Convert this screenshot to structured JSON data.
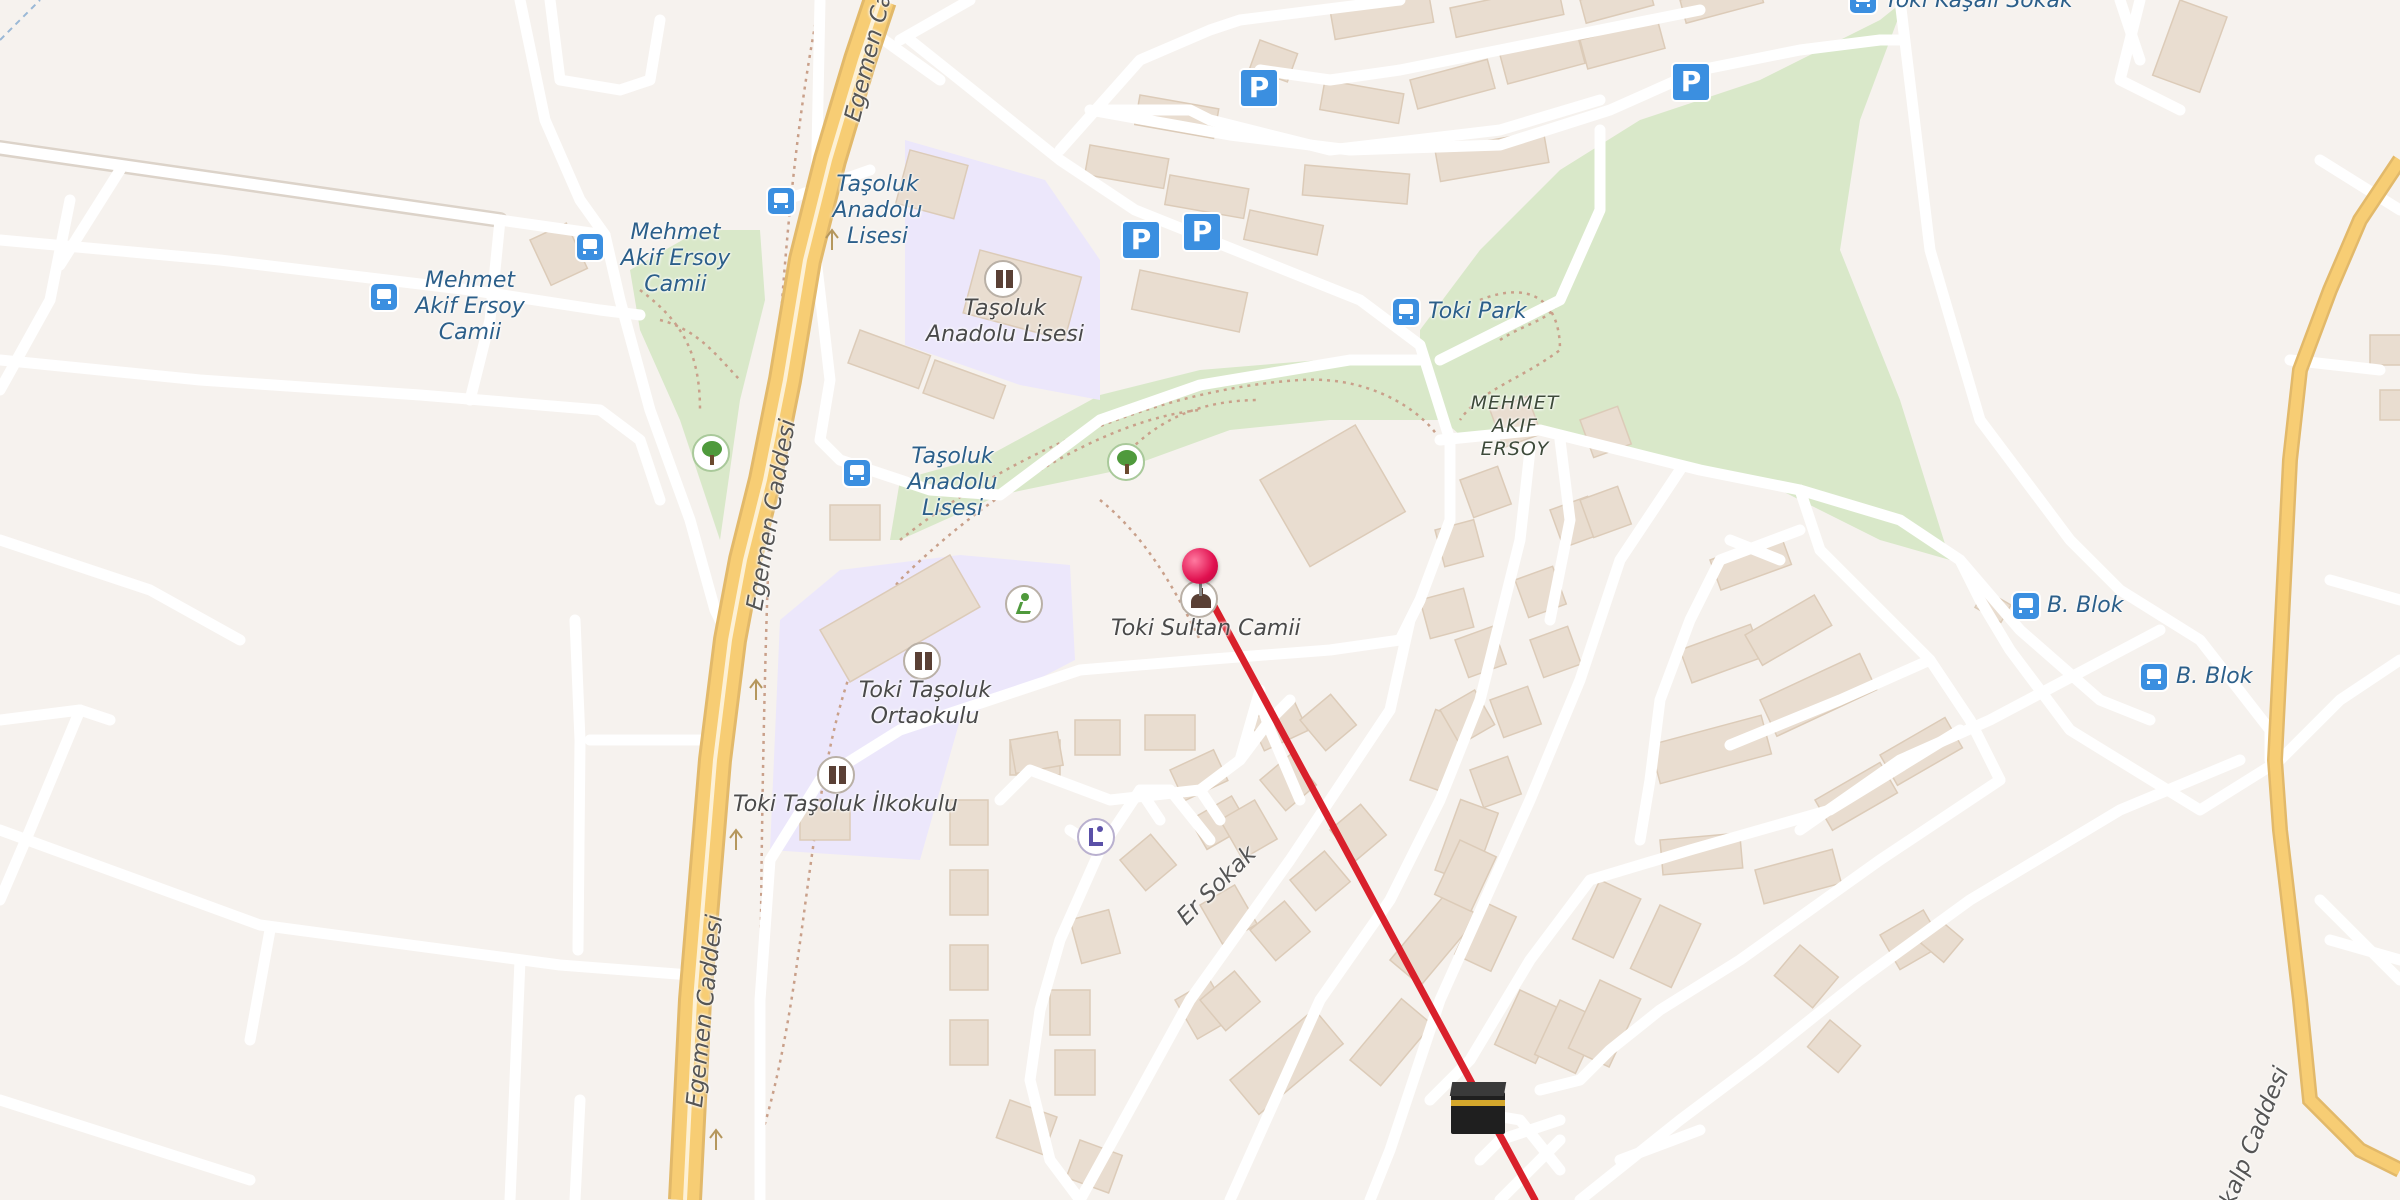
{
  "map": {
    "labels": {
      "egemen_caddesi_north": "Egemen Caddesi",
      "egemen_caddesi_middle": "Egemen Caddesi",
      "egemen_caddesi_south": "Egemen Caddesi",
      "er_sokak": "Er Sokak",
      "kalp_caddesi": "kalp Caddesi",
      "park_name": "MEHMET AKIF ERSOY"
    },
    "bus_stops": [
      {
        "name": "Mehmet Akif Ersoy Camii"
      },
      {
        "name": "Mehmet Akif Ersoy Camii"
      },
      {
        "name": "Taşoluk Anadolu Lisesi"
      },
      {
        "name": "Taşoluk Anadolu Lisesi"
      },
      {
        "name": "Toki Park"
      },
      {
        "name": "B. Blok"
      },
      {
        "name": "B. Blok"
      },
      {
        "name": "Toki Kaşalı Sokak"
      }
    ],
    "pois": {
      "school_lisesi": "Taşoluk Anadolu Lisesi",
      "school_ortaokulu": "Toki Taşoluk Ortaokulu",
      "school_ilkokulu": "Toki Taşoluk İlkokulu",
      "mosque": "Toki Sultan Camii"
    },
    "parking_symbol": "P",
    "icons": [
      "parking-icon",
      "bus-stop-icon",
      "school-icon",
      "tree-icon",
      "sports-icon",
      "mosque-icon",
      "fitness-icon",
      "location-pin-icon",
      "kaaba-icon"
    ],
    "colors": {
      "background": "#f6f2ee",
      "main_road": "#f7cd74",
      "minor_road": "#ffffff",
      "park": "#d9e8c9",
      "school_area": "#ece7fb",
      "building": "#e9ddd0",
      "qibla_line": "#d9202b",
      "pin": "#e0104f",
      "parking": "#3b8fe0"
    }
  }
}
